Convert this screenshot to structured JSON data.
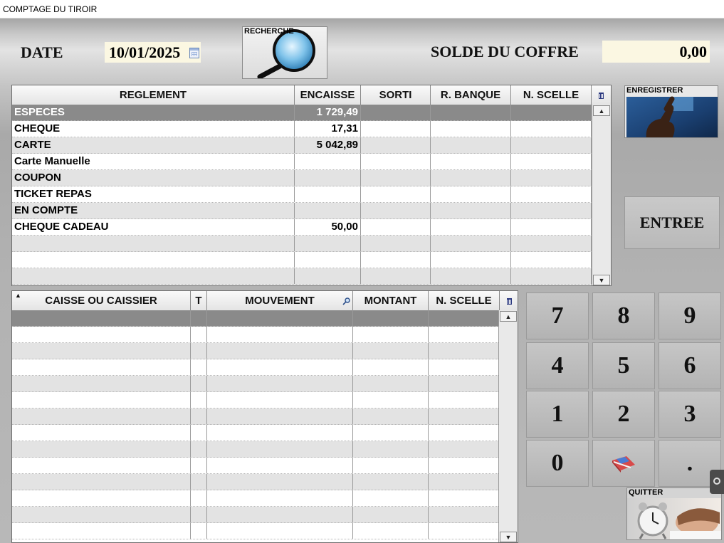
{
  "window": {
    "title": "COMPTAGE  DU TIROIR"
  },
  "header": {
    "date_label": "DATE",
    "date_value": "10/01/2025",
    "solde_label": "SOLDE DU COFFRE",
    "solde_value": "0,00",
    "recherche_label": "RECHERCHE"
  },
  "reglement_grid": {
    "columns": [
      "REGLEMENT",
      "ENCAISSE",
      "SORTI",
      "R. BANQUE",
      "N. SCELLE"
    ],
    "rows": [
      [
        "ESPECES",
        "1 729,49",
        "",
        "",
        ""
      ],
      [
        "CHEQUE",
        "17,31",
        "",
        "",
        ""
      ],
      [
        "CARTE",
        "5 042,89",
        "",
        "",
        ""
      ],
      [
        "Carte Manuelle",
        "",
        "",
        "",
        ""
      ],
      [
        "COUPON",
        "",
        "",
        "",
        ""
      ],
      [
        "TICKET REPAS",
        "",
        "",
        "",
        ""
      ],
      [
        "EN COMPTE",
        "",
        "",
        "",
        ""
      ],
      [
        "CHEQUE CADEAU",
        "50,00",
        "",
        "",
        ""
      ],
      [
        "",
        "",
        "",
        "",
        ""
      ],
      [
        "",
        "",
        "",
        "",
        ""
      ],
      [
        "",
        "",
        "",
        "",
        ""
      ]
    ],
    "selected_row": 0
  },
  "mouvement_grid": {
    "columns": [
      "CAISSE OU CAISSIER",
      "T",
      "MOUVEMENT",
      "MONTANT",
      "N. SCELLE"
    ],
    "row_count": 14,
    "selected_row": 0
  },
  "buttons": {
    "enregistrer": "ENREGISTRER",
    "entree": "ENTREE",
    "quitter": "QUITTER"
  },
  "keypad": [
    "7",
    "8",
    "9",
    "4",
    "5",
    "6",
    "1",
    "2",
    "3",
    "0",
    "",
    "."
  ],
  "icons": {
    "recherche": "magnifier-icon",
    "enregistrer": "finger-touch-icon",
    "quitter": "alarm-clock-icon",
    "delete": "trash-icon",
    "sort": "sort-up-icon",
    "filter": "search-icon",
    "calendar": "calendar-icon",
    "eraser": "eraser-icon"
  },
  "colors": {
    "field_bg": "#fbf7e2",
    "selected_row": "#8a8a8a",
    "grid_even_row": "#e3e3e3"
  }
}
